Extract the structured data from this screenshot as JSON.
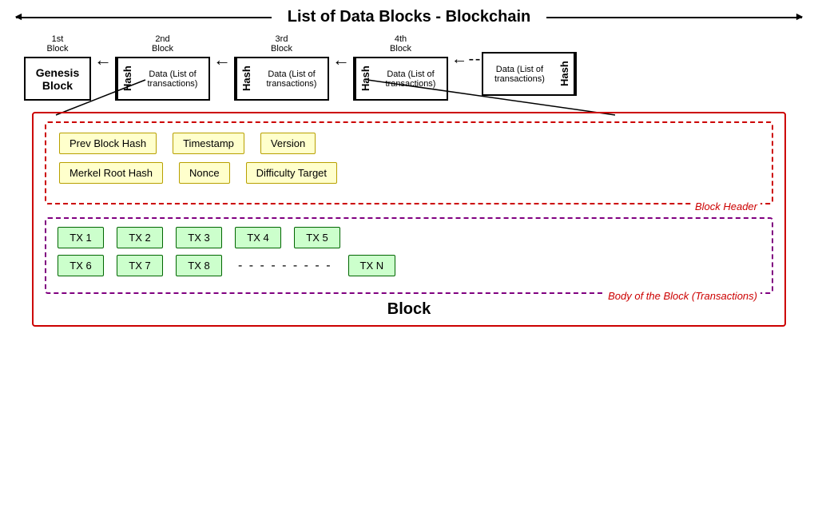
{
  "title": {
    "text": "List of Data Blocks - Blockchain"
  },
  "blocks": [
    {
      "label": "1st\nBlock",
      "type": "genesis",
      "text": "Genesis\nBlock"
    },
    {
      "label": "2nd\nBlock",
      "hash": "Hash",
      "data": "Data (List of\ntransactions)"
    },
    {
      "label": "3rd\nBlock",
      "hash": "Hash",
      "data": "Data (List of\ntransactions)"
    },
    {
      "label": "4th\nBlock",
      "hash": "Hash",
      "data": "Data (List of\ntransactions)"
    },
    {
      "label": "",
      "hash": "Hash",
      "data": "Data (List of\ntransactions)",
      "dashed": true
    }
  ],
  "blockHeader": {
    "fields_row1": [
      "Prev Block Hash",
      "Timestamp",
      "Version"
    ],
    "fields_row2": [
      "Merkel Root Hash",
      "Nonce",
      "Difficulty Target"
    ],
    "label": "Block Header"
  },
  "blockBody": {
    "tx_row1": [
      "TX 1",
      "TX 2",
      "TX 3",
      "TX 4",
      "TX 5"
    ],
    "tx_row2": [
      "TX 6",
      "TX 7",
      "TX 8",
      "TX N"
    ],
    "label": "Body of the Block (Transactions)"
  },
  "blockLabel": "Block"
}
